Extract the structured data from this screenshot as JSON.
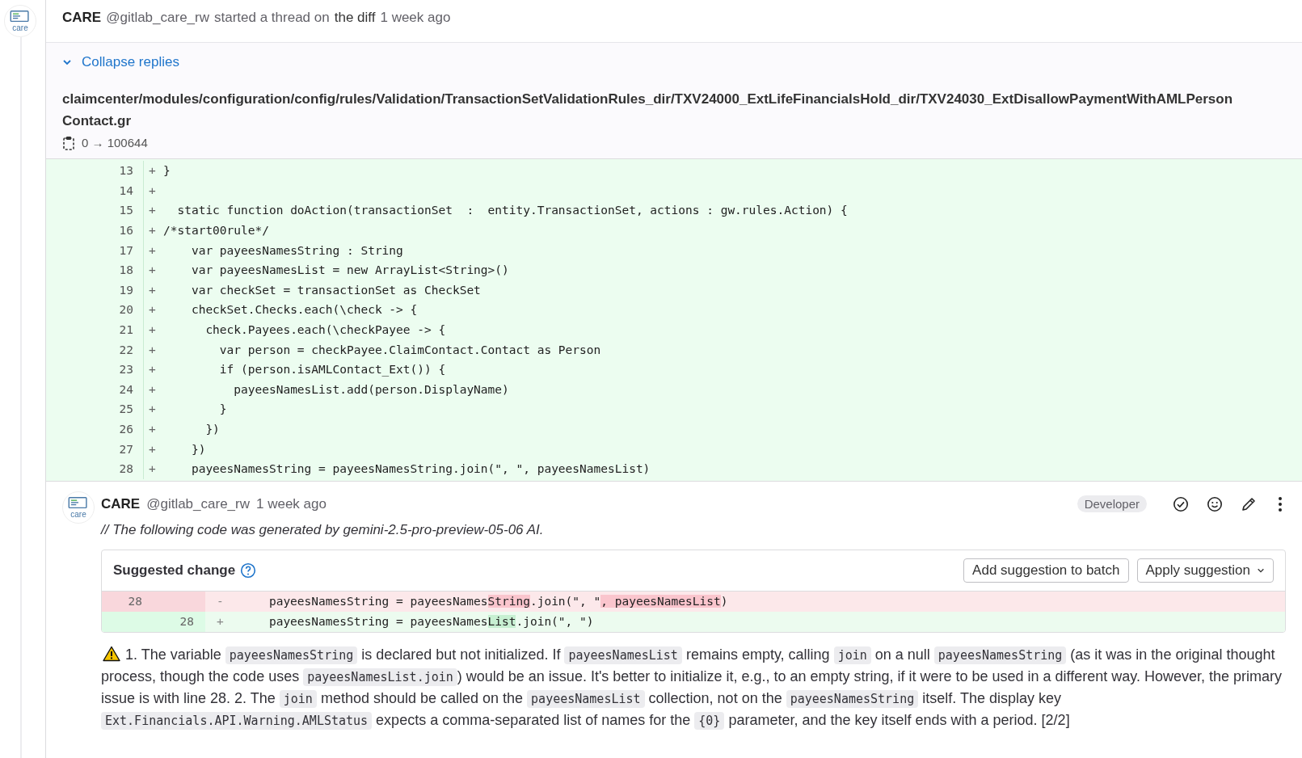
{
  "thread": {
    "author": "CARE",
    "avatar_label": "care",
    "handle": "@gitlab_care_rw",
    "action": "started a thread on",
    "target": "the diff",
    "time": "1 week ago"
  },
  "collapse": {
    "label": "Collapse replies",
    "expanded": true
  },
  "file": {
    "path": "claimcenter/modules/configuration/config/rules/Validation/TransactionSetValidationRules_dir/TXV24000_ExtLifeFinancialsHold_dir/TXV24030_ExtDisallowPaymentWithAMLPersonContact.gr",
    "mode": "0 → 100644"
  },
  "diff_lines": [
    {
      "number": "13",
      "sign": "+",
      "code": "}"
    },
    {
      "number": "14",
      "sign": "+"
    },
    {
      "number": "15",
      "sign": "+",
      "code": "  static function doAction(transactionSet  :  entity.TransactionSet, actions : gw.rules.Action) {"
    },
    {
      "number": "16",
      "sign": "+",
      "code": "/*start00rule*/"
    },
    {
      "number": "17",
      "sign": "+",
      "code": "    var payeesNamesString : String"
    },
    {
      "number": "18",
      "sign": "+",
      "code": "    var payeesNamesList = new ArrayList<String>()"
    },
    {
      "number": "19",
      "sign": "+",
      "code": "    var checkSet = transactionSet as CheckSet"
    },
    {
      "number": "20",
      "sign": "+",
      "code": "    checkSet.Checks.each(\\check -> {"
    },
    {
      "number": "21",
      "sign": "+",
      "code": "      check.Payees.each(\\checkPayee -> {"
    },
    {
      "number": "22",
      "sign": "+",
      "code": "        var person = checkPayee.ClaimContact.Contact as Person"
    },
    {
      "number": "23",
      "sign": "+",
      "code": "        if (person.isAMLContact_Ext()) {"
    },
    {
      "number": "24",
      "sign": "+",
      "code": "          payeesNamesList.add(person.DisplayName)"
    },
    {
      "number": "25",
      "sign": "+",
      "code": "        }"
    },
    {
      "number": "26",
      "sign": "+",
      "code": "      })"
    },
    {
      "number": "27",
      "sign": "+",
      "code": "    })"
    },
    {
      "number": "28",
      "sign": "+",
      "code": "    payeesNamesString = payeesNamesString.join(\", \", payeesNamesList)"
    }
  ],
  "note": {
    "author": "CARE",
    "avatar_label": "care",
    "handle": "@gitlab_care_rw",
    "time": "1 week ago",
    "role": "Developer",
    "intro": "// The following code was generated by gemini-2.5-pro-preview-05-06 AI.",
    "suggestion": {
      "title": "Suggested change",
      "add_button": "Add suggestion to batch",
      "apply_button": "Apply suggestion",
      "lines": [
        {
          "kind": "removed",
          "old_number": "28",
          "sign": "-",
          "segments": [
            {
              "text": "    payeesNamesString = payeesNames",
              "highlight": false
            },
            {
              "text": "String",
              "highlight": true
            },
            {
              "text": ".join(\", \"",
              "highlight": false
            },
            {
              "text": ", payeesNamesList",
              "highlight": true
            },
            {
              "text": ")",
              "highlight": false
            }
          ]
        },
        {
          "kind": "added",
          "new_number": "28",
          "sign": "+",
          "segments": [
            {
              "text": "    payeesNamesString = payeesNames",
              "highlight": false
            },
            {
              "text": "List",
              "highlight": true
            },
            {
              "text": ".join(\", \")",
              "highlight": false
            }
          ]
        }
      ]
    },
    "body": [
      {
        "kind": "text",
        "text": "1. The variable "
      },
      {
        "kind": "code",
        "text": "payeesNamesString"
      },
      {
        "kind": "text",
        "text": " is declared but not initialized. If "
      },
      {
        "kind": "code",
        "text": "payeesNamesList"
      },
      {
        "kind": "text",
        "text": " remains empty, calling "
      },
      {
        "kind": "code",
        "text": "join"
      },
      {
        "kind": "text",
        "text": " on a null "
      },
      {
        "kind": "code",
        "text": "payeesNamesString"
      },
      {
        "kind": "text",
        "text": " (as it was in the original thought process, though the code uses "
      },
      {
        "kind": "code",
        "text": "payeesNamesList.join"
      },
      {
        "kind": "text",
        "text": ") would be an issue. It's better to initialize it, e.g., to an empty string, if it were to be used in a different way. However, the primary issue is with line 28. 2. The "
      },
      {
        "kind": "code",
        "text": "join"
      },
      {
        "kind": "text",
        "text": " method should be called on the "
      },
      {
        "kind": "code",
        "text": "payeesNamesList"
      },
      {
        "kind": "text",
        "text": " collection, not on the "
      },
      {
        "kind": "code",
        "text": "payeesNamesString"
      },
      {
        "kind": "text",
        "text": " itself. The display key "
      },
      {
        "kind": "code",
        "text": "Ext.Financials.API.Warning.AMLStatus"
      },
      {
        "kind": "text",
        "text": " expects a comma-separated list of names for the "
      },
      {
        "kind": "code",
        "text": "{0}"
      },
      {
        "kind": "text",
        "text": " parameter, and the key itself ends with a period. [2/2]"
      }
    ]
  }
}
